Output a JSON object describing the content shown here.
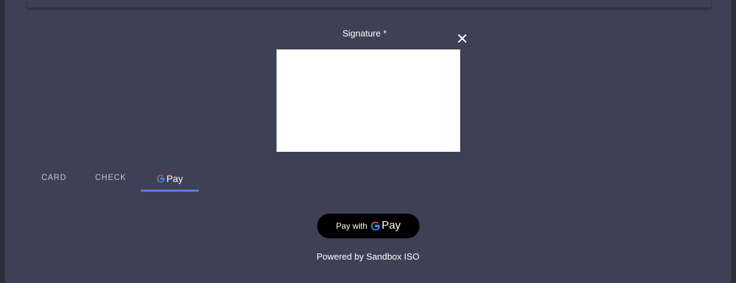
{
  "signature": {
    "label": "Signature *",
    "close_icon": "close-icon"
  },
  "tabs": [
    {
      "label": "CARD",
      "active": false
    },
    {
      "label": "CHECK",
      "active": false
    },
    {
      "label": "Pay",
      "icon": "google-g-icon",
      "active": true
    }
  ],
  "pay_button": {
    "prefix": "Pay with",
    "brand_word": "Pay",
    "icon": "google-g-icon"
  },
  "footer": {
    "powered_by": "Powered by Sandbox ISO"
  },
  "colors": {
    "background": "#3e4055",
    "tab_active_underline": "#5b7fe0",
    "tab_text": "#c3c5d3",
    "pay_button_bg": "#000000"
  }
}
